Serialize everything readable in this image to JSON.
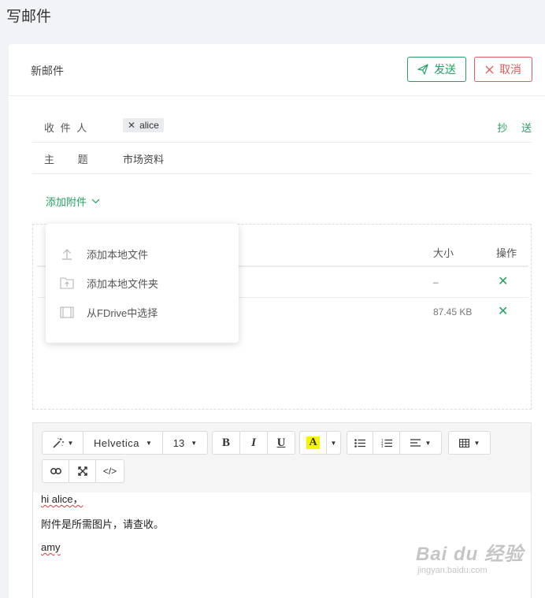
{
  "page": {
    "title": "写邮件"
  },
  "compose": {
    "title": "新邮件",
    "send_label": "发送",
    "cancel_label": "取消",
    "to_label": "收 件 人",
    "recipients": [
      {
        "name": "alice"
      }
    ],
    "cc_label": "抄 送",
    "subject_label": "主 题",
    "subject_value": "市场资料"
  },
  "attachments": {
    "add_label": "添加附件",
    "menu": [
      {
        "label": "添加本地文件",
        "icon": "upload-icon"
      },
      {
        "label": "添加本地文件夹",
        "icon": "folder-upload-icon"
      },
      {
        "label": "从FDrive中选择",
        "icon": "fdrive-icon"
      }
    ],
    "columns": {
      "size": "大小",
      "action": "操作"
    },
    "rows": [
      {
        "size": "–"
      },
      {
        "size": "87.45 KB"
      }
    ]
  },
  "toolbar": {
    "style_icon": "magic-wand-icon",
    "font_name": "Helvetica",
    "font_size": "13",
    "bold": "B",
    "italic": "I",
    "underline": "U",
    "highlight": "A",
    "code": "</>"
  },
  "body": {
    "line1": "hi alice，",
    "line2": "附件是所需图片，请查收。",
    "line3": "amy"
  },
  "watermark": {
    "brand": "Bai du 经验",
    "url": "jingyan.baidu.com"
  },
  "colors": {
    "accent": "#24a060",
    "danger": "#e05c5c",
    "highlight": "#f5f500"
  }
}
